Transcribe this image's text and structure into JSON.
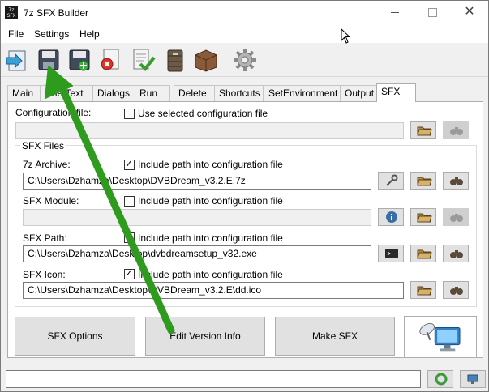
{
  "window": {
    "title": "7z SFX Builder",
    "icon_text": "7z SFX",
    "close_glyph": "✕"
  },
  "menu": [
    "File",
    "Settings",
    "Help"
  ],
  "toolbar": {
    "icons": [
      "open-icon",
      "save-icon",
      "save-as-icon",
      "delete-icon",
      "check-document-icon",
      "archive-icon",
      "box-icon",
      "gear-icon"
    ]
  },
  "tabs": [
    "Main",
    "Title/Text",
    "Dialogs",
    "Run",
    "Delete",
    "Shortcuts",
    "SetEnvironment",
    "Output",
    "SFX"
  ],
  "active_tab": "SFX",
  "sfx": {
    "config_file_label": "Configuration file:",
    "use_config_label": "Use selected configuration file",
    "use_config_checked": false,
    "config_path": "",
    "group_title": "SFX Files",
    "archive_label": "7z Archive:",
    "archive_include_label": "Include path into configuration file",
    "archive_include_checked": true,
    "archive_path": "C:\\Users\\Dzhamza\\Desktop\\DVBDream_v3.2.E.7z",
    "module_label": "SFX Module:",
    "module_include_label": "Include path into configuration file",
    "module_include_checked": false,
    "module_path": "",
    "path_label": "SFX Path:",
    "path_include_label": "Include path into configuration file",
    "path_include_checked": true,
    "sfx_path": "C:\\Users\\Dzhamza\\Desktop\\dvbdreamsetup_v32.exe",
    "icon_label": "SFX Icon:",
    "icon_include_label": "Include path into configuration file",
    "icon_include_checked": true,
    "icon_path": "C:\\Users\\Dzhamza\\Desktop\\DVBDream_v3.2.E\\dd.ico"
  },
  "buttons": {
    "sfx_options": "SFX Options",
    "edit_version": "Edit Version Info",
    "make_sfx": "Make SFX"
  },
  "status": {
    "value": ""
  },
  "colors": {
    "annotation_arrow": "#2e9b1e"
  }
}
